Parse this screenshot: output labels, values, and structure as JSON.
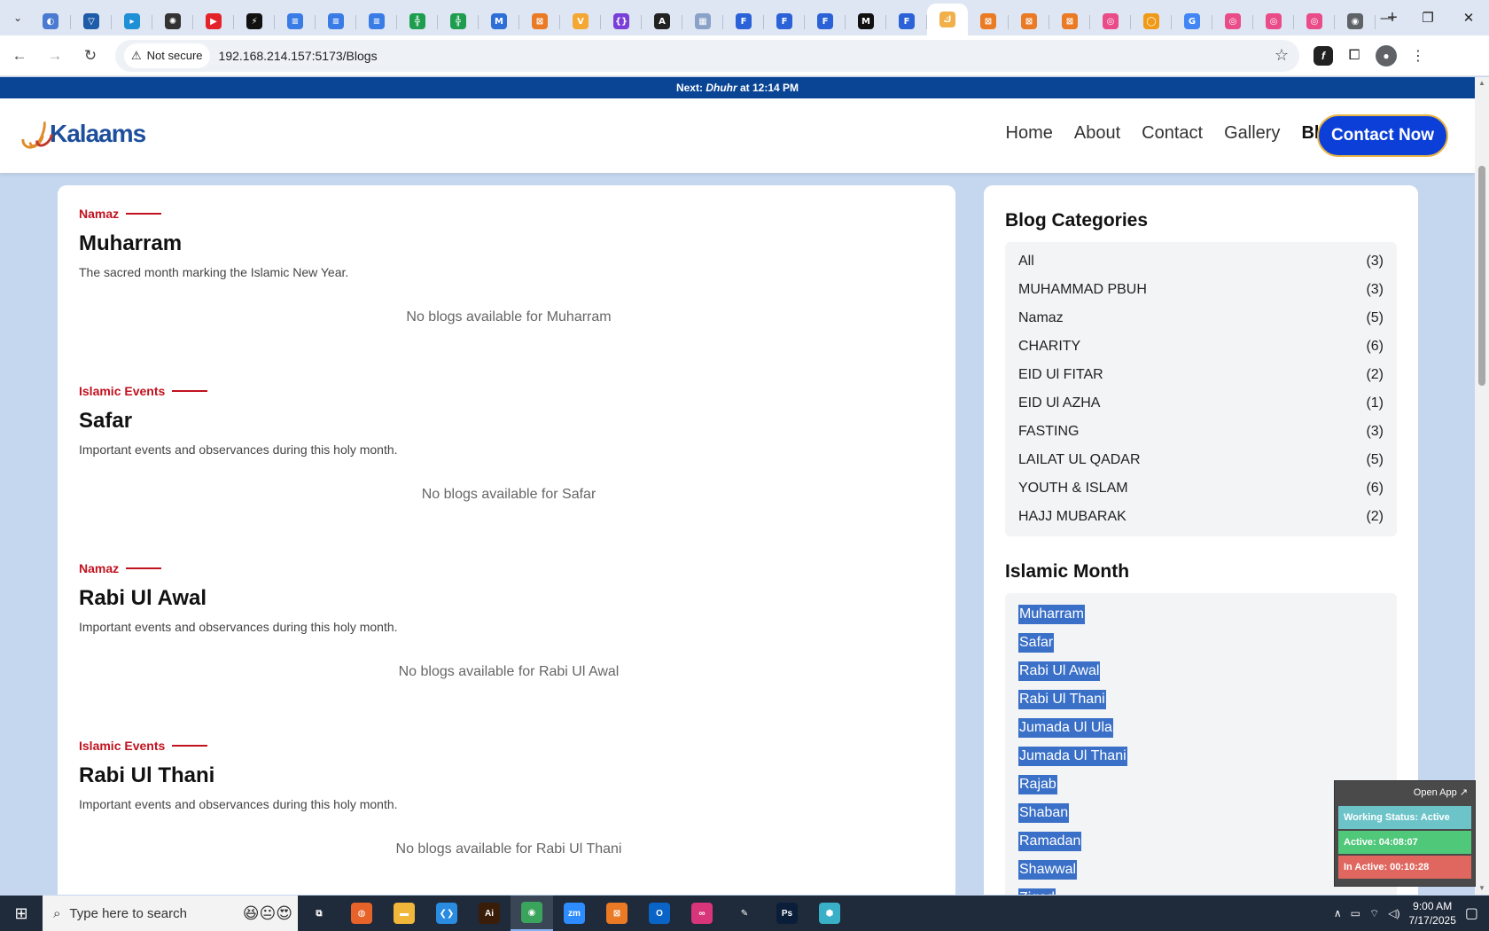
{
  "browser": {
    "tabs": [
      {
        "icon": "tab-icon-1",
        "color": "#4a7bd0",
        "glyph": "◐"
      },
      {
        "icon": "tab-icon-2",
        "color": "#1e5ba8",
        "glyph": "▽"
      },
      {
        "icon": "tab-icon-3",
        "color": "#1f8fd6",
        "glyph": "▸"
      },
      {
        "icon": "chatgpt-icon",
        "color": "#333333",
        "glyph": "✺"
      },
      {
        "icon": "youtube-icon",
        "color": "#e3222a",
        "glyph": "▶"
      },
      {
        "icon": "bolt-icon",
        "color": "#111111",
        "glyph": "⚡"
      },
      {
        "icon": "docs-icon",
        "color": "#3a7ce6",
        "glyph": "≡"
      },
      {
        "icon": "docs-icon",
        "color": "#3a7ce6",
        "glyph": "≡"
      },
      {
        "icon": "docs-icon",
        "color": "#3a7ce6",
        "glyph": "≡"
      },
      {
        "icon": "sheets-icon",
        "color": "#1e9d4f",
        "glyph": "╬"
      },
      {
        "icon": "sheets-icon",
        "color": "#1e9d4f",
        "glyph": "╬"
      },
      {
        "icon": "tab-icon-mq",
        "color": "#2d6fd6",
        "glyph": "M"
      },
      {
        "icon": "xampp-icon",
        "color": "#ea7a24",
        "glyph": "⊠"
      },
      {
        "icon": "tab-icon-v",
        "color": "#f4a732",
        "glyph": "V"
      },
      {
        "icon": "tab-icon-brackets",
        "color": "#7a3fd8",
        "glyph": "{}"
      },
      {
        "icon": "tab-icon-a",
        "color": "#222222",
        "glyph": "A"
      },
      {
        "icon": "tab-icon-grid",
        "color": "#8aa2c8",
        "glyph": "▦"
      },
      {
        "icon": "forms-icon",
        "color": "#2b62d8",
        "glyph": "F"
      },
      {
        "icon": "forms-icon",
        "color": "#2b62d8",
        "glyph": "F"
      },
      {
        "icon": "forms-icon",
        "color": "#2b62d8",
        "glyph": "F"
      },
      {
        "icon": "tab-icon-m",
        "color": "#111111",
        "glyph": "M"
      },
      {
        "icon": "forms-icon",
        "color": "#2b62d8",
        "glyph": "F"
      },
      {
        "icon": "kalaams-icon",
        "color": "#f1b04a",
        "glyph": "ﻙ",
        "active": true
      },
      {
        "icon": "xampp-icon",
        "color": "#ea7a24",
        "glyph": "⊠"
      },
      {
        "icon": "xampp-icon",
        "color": "#ea7a24",
        "glyph": "⊠"
      },
      {
        "icon": "xampp-icon",
        "color": "#ea7a24",
        "glyph": "⊠"
      },
      {
        "icon": "dribbble-icon",
        "color": "#ea4c89",
        "glyph": "◎"
      },
      {
        "icon": "tab-icon-ring",
        "color": "#f09a18",
        "glyph": "◯"
      },
      {
        "icon": "google-icon",
        "color": "#4285f4",
        "glyph": "G"
      },
      {
        "icon": "dribbble-icon",
        "color": "#ea4c89",
        "glyph": "◎"
      },
      {
        "icon": "dribbble-icon",
        "color": "#ea4c89",
        "glyph": "◎"
      },
      {
        "icon": "dribbble-icon",
        "color": "#ea4c89",
        "glyph": "◎"
      },
      {
        "icon": "chrome-icon",
        "color": "#5f6368",
        "glyph": "◉"
      }
    ],
    "security_label": "Not secure",
    "url": "192.168.214.157:5173/Blogs"
  },
  "prayer_bar": {
    "prefix": "Next:",
    "prayer": "Dhuhr",
    "suffix": "at 12:14 PM"
  },
  "header": {
    "logo_text": "Kalaams",
    "nav": [
      "Home",
      "About",
      "Contact",
      "Gallery",
      "Blogs"
    ],
    "active_nav": "Blogs",
    "cta": "Contact Now",
    "brand_color": "#0b3fd8",
    "accent_color": "#e9b545"
  },
  "months": [
    {
      "tag": "Namaz",
      "title": "Muharram",
      "description": "The sacred month marking the Islamic New Year.",
      "empty": "No blogs available for Muharram"
    },
    {
      "tag": "Islamic Events",
      "title": "Safar",
      "description": "Important events and observances during this holy month.",
      "empty": "No blogs available for Safar"
    },
    {
      "tag": "Namaz",
      "title": "Rabi Ul Awal",
      "description": "Important events and observances during this holy month.",
      "empty": "No blogs available for Rabi Ul Awal"
    },
    {
      "tag": "Islamic Events",
      "title": "Rabi Ul Thani",
      "description": "Important events and observances during this holy month.",
      "empty": "No blogs available for Rabi Ul Thani"
    }
  ],
  "sidebar": {
    "categories_title": "Blog Categories",
    "categories": [
      {
        "name": "All",
        "count": "(3)"
      },
      {
        "name": "MUHAMMAD PBUH",
        "count": "(3)"
      },
      {
        "name": "Namaz",
        "count": "(5)"
      },
      {
        "name": "CHARITY",
        "count": "(6)"
      },
      {
        "name": "EID Ul FITAR",
        "count": "(2)"
      },
      {
        "name": "EID Ul AZHA",
        "count": "(1)"
      },
      {
        "name": "FASTING",
        "count": "(3)"
      },
      {
        "name": "LAILAT UL QADAR",
        "count": "(5)"
      },
      {
        "name": "YOUTH & ISLAM",
        "count": "(6)"
      },
      {
        "name": "HAJJ MUBARAK",
        "count": "(2)"
      }
    ],
    "months_title": "Islamic Month",
    "months": [
      "Muharram",
      "Safar",
      "Rabi Ul Awal",
      "Rabi Ul Thani",
      "Jumada Ul Ula",
      "Jumada Ul Thani",
      "Rajab",
      "Shaban",
      "Ramadan",
      "Shawwal",
      "Ziqad"
    ]
  },
  "widget": {
    "open_app": "Open App ↗",
    "working_status": "Working Status: Active",
    "active": "Active: 04:08:07",
    "inactive": "In Active: 00:10:28",
    "colors": {
      "working": "#6cc4c9",
      "active": "#4fc87a",
      "inactive": "#e0675f"
    }
  },
  "taskbar": {
    "search_placeholder": "Type here to search",
    "apps": [
      {
        "icon": "task-view-icon",
        "color": "#1f2a3a",
        "glyph": "⧉"
      },
      {
        "icon": "firefox-icon",
        "color": "#e8632a",
        "glyph": "◍"
      },
      {
        "icon": "file-explorer-icon",
        "color": "#f1b73a",
        "glyph": "▬"
      },
      {
        "icon": "vscode-icon",
        "color": "#2a8ce0",
        "glyph": "❮❯"
      },
      {
        "icon": "illustrator-icon",
        "color": "#3a1d08",
        "glyph": "Ai"
      },
      {
        "icon": "chrome-icon",
        "color": "#3aa35c",
        "glyph": "◉",
        "active": true
      },
      {
        "icon": "zoom-icon",
        "color": "#2d8cff",
        "glyph": "zm"
      },
      {
        "icon": "xampp-icon",
        "color": "#ea7a24",
        "glyph": "⊠"
      },
      {
        "icon": "outlook-icon",
        "color": "#0a64c8",
        "glyph": "O"
      },
      {
        "icon": "creative-cloud-icon",
        "color": "#d8357a",
        "glyph": "∞"
      },
      {
        "icon": "pen-tool-icon",
        "color": "#1f2a3a",
        "glyph": "✎"
      },
      {
        "icon": "photoshop-icon",
        "color": "#0a1e3a",
        "glyph": "Ps"
      },
      {
        "icon": "app-hex-icon",
        "color": "#3ab0c8",
        "glyph": "⬢"
      }
    ],
    "time": "9:00 AM",
    "date": "7/17/2025"
  }
}
